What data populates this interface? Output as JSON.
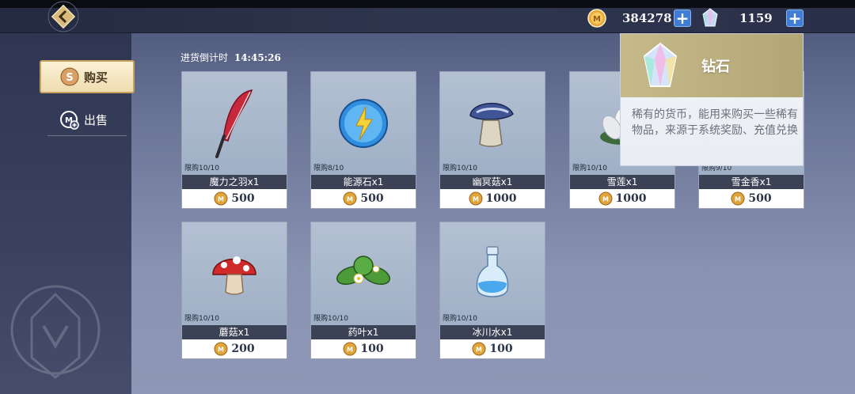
{
  "currencies": {
    "gold_value": "384278",
    "diamond_value": "1159"
  },
  "sidebar": {
    "buy_label": "购买",
    "sell_label": "出售"
  },
  "countdown": {
    "label": "进货倒计时",
    "time": "14:45:26"
  },
  "items": [
    {
      "limit": "限购10/10",
      "name": "魔力之羽x1",
      "price": "500",
      "icon": "feather-icon"
    },
    {
      "limit": "限购8/10",
      "name": "能源石x1",
      "price": "500",
      "icon": "energy-stone-icon"
    },
    {
      "limit": "限购10/10",
      "name": "幽冥菇x1",
      "price": "1000",
      "icon": "nether-mushroom-icon"
    },
    {
      "limit": "限购10/10",
      "name": "雪莲x1",
      "price": "1000",
      "icon": "snow-lotus-icon"
    },
    {
      "limit": "限购9/10",
      "name": "雪金香x1",
      "price": "500",
      "icon": "snow-tulip-icon"
    },
    {
      "limit": "限购10/10",
      "name": "蘑菇x1",
      "price": "200",
      "icon": "mushroom-icon"
    },
    {
      "limit": "限购10/10",
      "name": "药叶x1",
      "price": "100",
      "icon": "herb-leaf-icon"
    },
    {
      "limit": "限购10/10",
      "name": "冰川水x1",
      "price": "100",
      "icon": "glacier-water-icon"
    }
  ],
  "tooltip": {
    "title": "钻石",
    "description": "稀有的货币，能用来购买一些稀有物品，来源于系统奖励、充值兑换"
  },
  "colors": {
    "accent_gold": "#e0a53a",
    "plus_blue": "#3f7ed4",
    "name_bar": "#3b4256"
  }
}
